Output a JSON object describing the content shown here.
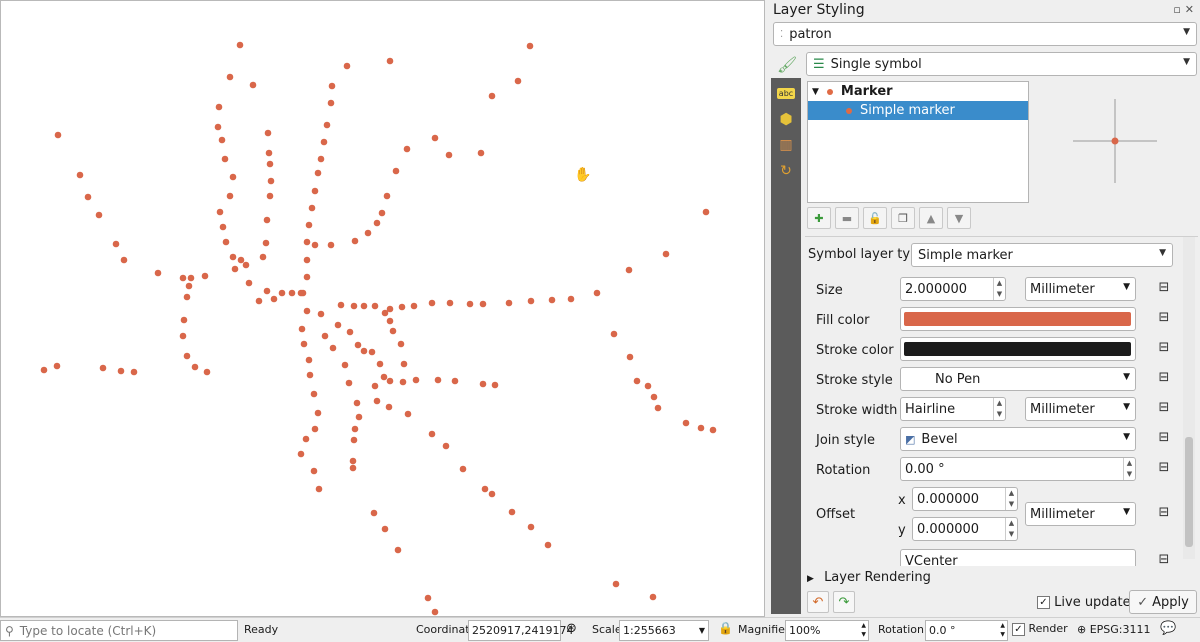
{
  "panel": {
    "title": "Layer Styling",
    "layer": "patron",
    "renderer": "Single symbol",
    "tree": [
      {
        "label": "Marker",
        "bold": true
      },
      {
        "label": "Simple marker",
        "selected": true
      }
    ],
    "symbol_layer_type_label": "Symbol layer type",
    "symbol_layer_type": "Simple marker",
    "size_label": "Size",
    "size_value": "2.000000",
    "size_unit": "Millimeter",
    "fill_color_label": "Fill color",
    "fill_color": "#d9674a",
    "stroke_color_label": "Stroke color",
    "stroke_color": "#1c1c1c",
    "stroke_style_label": "Stroke style",
    "stroke_style": "No Pen",
    "stroke_width_label": "Stroke width",
    "stroke_width": "Hairline",
    "stroke_width_unit": "Millimeter",
    "join_style_label": "Join style",
    "join_style": "Bevel",
    "rotation_label": "Rotation",
    "rotation_value": "0.00 °",
    "offset_label": "Offset",
    "offset_x_label": "x",
    "offset_x": "0.000000",
    "offset_y_label": "y",
    "offset_y": "0.000000",
    "offset_unit": "Millimeter",
    "anchor_partial": "VCenter",
    "layer_rendering": "Layer Rendering",
    "live_update": "Live update",
    "apply": "Apply"
  },
  "status": {
    "locate_placeholder": "Type to locate (Ctrl+K)",
    "ready": "Ready",
    "coordinate_label": "Coordinate",
    "coordinate": "2520917,2419174",
    "scale_label": "Scale",
    "scale": "1:255663",
    "magnifier_label": "Magnifier",
    "magnifier": "100%",
    "rotation_label": "Rotation",
    "rotation": "0.0 °",
    "render_label": "Render",
    "crs": "EPSG:3111"
  },
  "colors": {
    "marker": "#d9674a",
    "selection": "#3a8ccb"
  }
}
